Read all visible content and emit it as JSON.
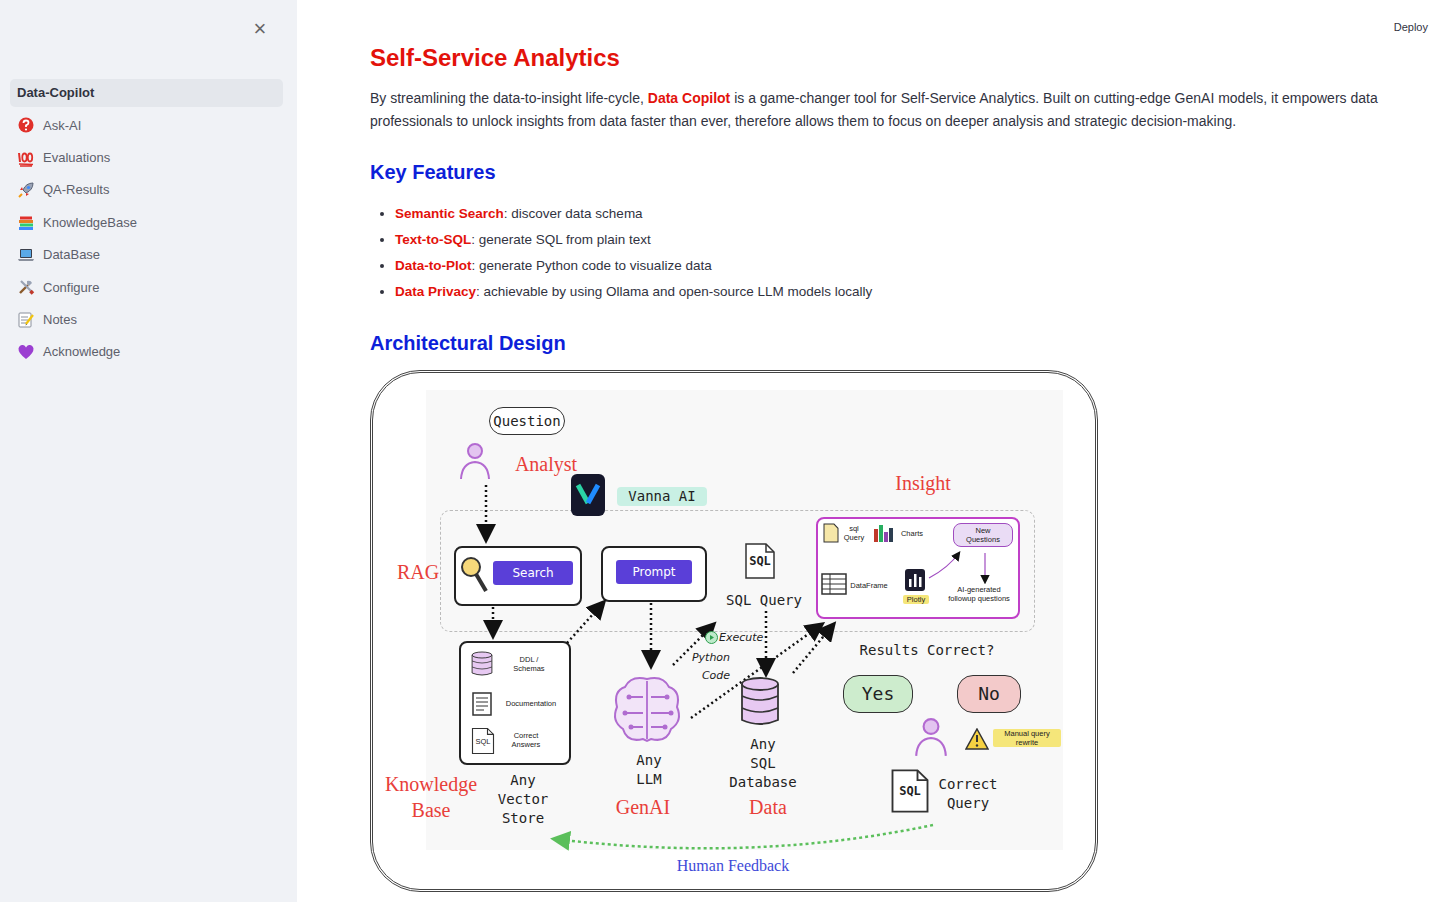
{
  "header": {
    "deploy": "Deploy"
  },
  "sidebar": {
    "close": "×",
    "items": [
      {
        "label": "Data-Copilot",
        "selected": true
      },
      {
        "label": "Ask-AI",
        "selected": false
      },
      {
        "label": "Evaluations",
        "selected": false
      },
      {
        "label": "QA-Results",
        "selected": false
      },
      {
        "label": "KnowledgeBase",
        "selected": false
      },
      {
        "label": "DataBase",
        "selected": false
      },
      {
        "label": "Configure",
        "selected": false
      },
      {
        "label": "Notes",
        "selected": false
      },
      {
        "label": "Acknowledge",
        "selected": false
      }
    ]
  },
  "main": {
    "title": "Self-Service Analytics",
    "intro": {
      "before": "By streamlining the data-to-insight life-cycle, ",
      "highlight": "Data Copilot",
      "after": " is a game-changer tool for Self-Service Analytics. Built on cutting-edge GenAI models, it empowers data professionals to unlock insights from data faster than ever, therefore allows them to focus on deeper analysis and strategic decision-making."
    },
    "features_heading": "Key Features",
    "features": [
      {
        "term": "Semantic Search",
        "desc": ": discover data schema"
      },
      {
        "term": "Text-to-SQL",
        "desc": ": generate SQL from plain text"
      },
      {
        "term": "Data-to-Plot",
        "desc": ": generate Python code to visualize data"
      },
      {
        "term": "Data Privacy",
        "desc": ": achievable by using Ollama and open-source LLM models locally"
      }
    ],
    "design_heading": "Architectural Design"
  },
  "diagram": {
    "labels": [
      {
        "kind": "bubble",
        "lines": [
          "Question"
        ]
      },
      {
        "kind": "serif-red",
        "lines": [
          "Analyst"
        ]
      },
      {
        "kind": "hand-hl",
        "lines": [
          "Vanna AI"
        ]
      },
      {
        "kind": "serif-red",
        "lines": [
          "RAG"
        ]
      },
      {
        "kind": "button",
        "lines": [
          "Search"
        ]
      },
      {
        "kind": "button",
        "lines": [
          "Prompt"
        ]
      },
      {
        "kind": "doc-text",
        "lines": [
          "SQL"
        ]
      },
      {
        "kind": "hand",
        "lines": [
          "SQL Query"
        ]
      },
      {
        "kind": "serif-red",
        "lines": [
          "Insight"
        ]
      },
      {
        "kind": "tiny",
        "lines": [
          "sql",
          "Query"
        ]
      },
      {
        "kind": "tiny",
        "lines": [
          "Charts"
        ]
      },
      {
        "kind": "tiny-bubble",
        "lines": [
          "New",
          "Questions"
        ]
      },
      {
        "kind": "tiny",
        "lines": [
          "DataFrame"
        ]
      },
      {
        "kind": "tiny-yellow",
        "lines": [
          "Plotly"
        ]
      },
      {
        "kind": "tiny",
        "lines": [
          "AI-generated",
          "followup questions"
        ]
      },
      {
        "kind": "tiny",
        "lines": [
          "DDL /",
          "Schemas"
        ]
      },
      {
        "kind": "tiny",
        "lines": [
          "Documentation"
        ]
      },
      {
        "kind": "tiny",
        "lines": [
          "Correct",
          "Answers"
        ]
      },
      {
        "kind": "serif-red",
        "lines": [
          "Knowledge",
          "Base"
        ]
      },
      {
        "kind": "hand",
        "lines": [
          "Any",
          "Vector",
          "Store"
        ]
      },
      {
        "kind": "hand",
        "lines": [
          "Any",
          "LLM"
        ]
      },
      {
        "kind": "serif-red",
        "lines": [
          "GenAI"
        ]
      },
      {
        "kind": "hand-small",
        "lines": [
          "Python"
        ]
      },
      {
        "kind": "hand-small",
        "lines": [
          "Code"
        ]
      },
      {
        "kind": "hand-small",
        "lines": [
          "Execute"
        ]
      },
      {
        "kind": "hand",
        "lines": [
          "Any",
          "SQL",
          "Database"
        ]
      },
      {
        "kind": "serif-red",
        "lines": [
          "Data"
        ]
      },
      {
        "kind": "hand",
        "lines": [
          "Results Correct?"
        ]
      },
      {
        "kind": "bubble-yes",
        "lines": [
          "Yes"
        ]
      },
      {
        "kind": "bubble-no",
        "lines": [
          "No"
        ]
      },
      {
        "kind": "tiny-yellow",
        "lines": [
          "Manual query",
          "rewrite"
        ]
      },
      {
        "kind": "doc-text",
        "lines": [
          "SQL"
        ]
      },
      {
        "kind": "hand",
        "lines": [
          "Correct",
          "Query"
        ]
      },
      {
        "kind": "serif-blue",
        "lines": [
          "Human Feedback"
        ]
      },
      {
        "kind": "tiny",
        "lines": [
          "SQL"
        ]
      }
    ]
  }
}
